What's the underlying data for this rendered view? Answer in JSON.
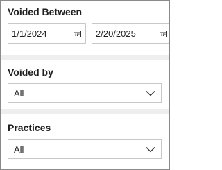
{
  "filters": {
    "voided_between": {
      "title": "Voided Between",
      "from_value": "1/1/2024",
      "to_value": "2/20/2025"
    },
    "voided_by": {
      "title": "Voided by",
      "selected": "All"
    },
    "practices": {
      "title": "Practices",
      "selected": "All"
    }
  },
  "icons": {
    "date_picker": "calendar-icon",
    "dropdown": "chevron-down-icon"
  },
  "colors": {
    "border": "#c8c8c8",
    "separator": "#eeeeee",
    "text": "#1f1f1f"
  }
}
